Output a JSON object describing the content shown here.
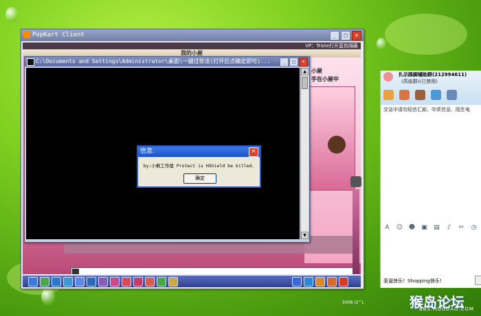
{
  "popkart": {
    "title": "PopKart Client",
    "top_strip_text": "VP：Triste打开蓝色隔蔽",
    "room_title": "我的小屋",
    "room_side_label1": "小屋",
    "room_side_label2": "手在小屋中"
  },
  "cmd": {
    "title": "C:\\Documents and Settings\\Administrator\\桌面\\一键过非法(打开后点确定即可)..."
  },
  "msgbox": {
    "title": "信息:",
    "text": "by:小枫工作组 Protect is HShield be killed.",
    "ok_label": "确定"
  },
  "qq": {
    "group_name": "扎示踩脚辅助群(212994611)",
    "group_sub": "(高级群)(已禁用)",
    "notice": "交谈中请勿轻信汇款、中奖信息、陌生电",
    "bottom_text": "圣诞快乐！Shopping快乐！"
  },
  "watermark": {
    "logo": "猴岛论坛",
    "url": "BBS.HOUDAO.COM",
    "stamp": "5008 (2^L"
  },
  "colors": {
    "accent": "#2b58c9",
    "desktop": "#7fd020",
    "close": "#d9412a"
  }
}
